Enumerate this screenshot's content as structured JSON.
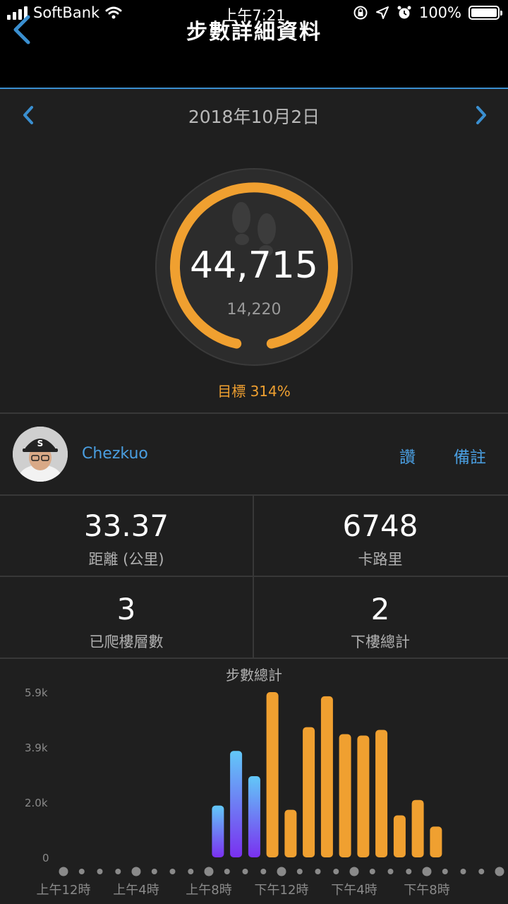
{
  "status_bar": {
    "carrier": "SoftBank",
    "time": "上午7:21",
    "battery": "100%"
  },
  "nav": {
    "title": "步數詳細資料"
  },
  "date": {
    "label": "2018年10月2日"
  },
  "ring": {
    "steps": "44,715",
    "goal_steps": "14,220",
    "progress_fraction": 1.0
  },
  "goal_percent_label": "目標 314%",
  "user": {
    "name": "Chezkuo",
    "like_label": "讚",
    "note_label": "備註"
  },
  "stats": [
    {
      "value": "33.37",
      "label": "距離 (公里)"
    },
    {
      "value": "6748",
      "label": "卡路里"
    },
    {
      "value": "3",
      "label": "已爬樓層數"
    },
    {
      "value": "2",
      "label": "下樓總計"
    }
  ],
  "colors": {
    "accent_orange": "#f0a030",
    "link_blue": "#4a9ee0",
    "purple": "#7a30f0",
    "cyan": "#62c8f8"
  },
  "chart_data": {
    "type": "bar",
    "title": "步數總計",
    "y_ticks": [
      "5.9k",
      "3.9k",
      "2.0k",
      "0"
    ],
    "ylim": [
      0,
      5900
    ],
    "x_labels": [
      "上午12時",
      "上午4時",
      "上午8時",
      "下午12時",
      "下午4時",
      "下午8時"
    ],
    "bins": 24,
    "bars": [
      {
        "hour": 8,
        "value": 1850,
        "color": "gradient"
      },
      {
        "hour": 9,
        "value": 3800,
        "color": "gradient"
      },
      {
        "hour": 10,
        "value": 2900,
        "color": "gradient"
      },
      {
        "hour": 11,
        "value": 5900,
        "color": "orange"
      },
      {
        "hour": 12,
        "value": 1700,
        "color": "orange"
      },
      {
        "hour": 13,
        "value": 4650,
        "color": "orange"
      },
      {
        "hour": 14,
        "value": 5750,
        "color": "orange"
      },
      {
        "hour": 15,
        "value": 4400,
        "color": "orange"
      },
      {
        "hour": 16,
        "value": 4350,
        "color": "orange"
      },
      {
        "hour": 17,
        "value": 4550,
        "color": "orange"
      },
      {
        "hour": 18,
        "value": 1500,
        "color": "orange"
      },
      {
        "hour": 19,
        "value": 2050,
        "color": "orange"
      },
      {
        "hour": 20,
        "value": 1100,
        "color": "orange"
      }
    ]
  }
}
